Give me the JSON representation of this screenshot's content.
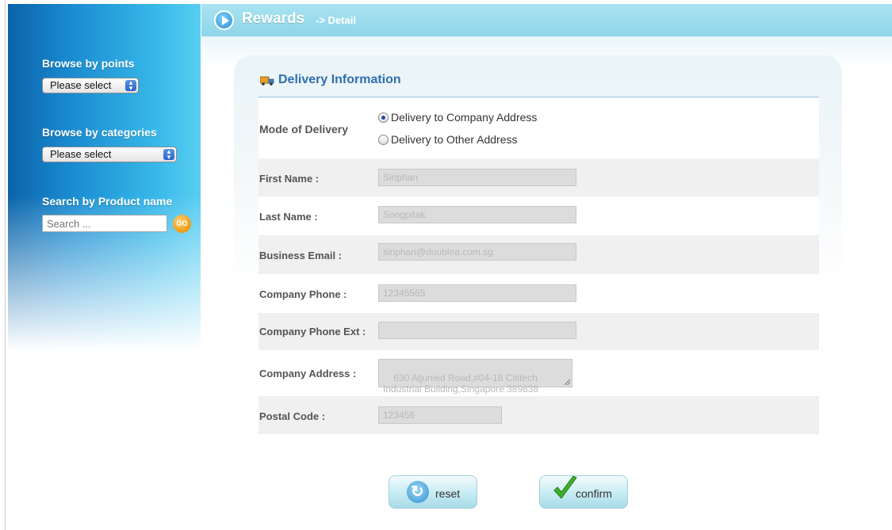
{
  "header": {
    "title": "Rewards",
    "subtitle": "-> Detail"
  },
  "sidebar": {
    "browse_points_heading": "Browse by points",
    "browse_points_select": "Please select",
    "browse_categories_heading": "Browse by categories",
    "browse_categories_select": "Please select",
    "search_heading": "Search by Product name",
    "search_placeholder": "Search ...",
    "go_label": "GO"
  },
  "panel": {
    "title": "Delivery Information",
    "mode_label": "Mode of Delivery",
    "delivery_options": [
      {
        "label": "Delivery to Company Address",
        "selected": true
      },
      {
        "label": "Delivery to Other Address",
        "selected": false
      }
    ],
    "fields": {
      "first_name": {
        "label": "First Name  :",
        "value": "Siriphan"
      },
      "last_name": {
        "label": "Last Name  :",
        "value": "Songpitak"
      },
      "business_email": {
        "label": "Business Email  :",
        "value": "siriphan@doublea.com.sg"
      },
      "company_phone": {
        "label": "Company Phone  :",
        "value": "12345565"
      },
      "company_phone_ext": {
        "label": "Company Phone Ext  :",
        "value": ""
      },
      "company_address": {
        "label": "Company Address  :",
        "value": "630 Aljunied Road,#04-18 Cititech Industrial Building,Singapore 389838"
      },
      "postal_code": {
        "label": "Postal Code  :",
        "value": "123456"
      }
    }
  },
  "buttons": {
    "reset": "reset",
    "confirm": "confirm"
  },
  "colors": {
    "accent": "#2f6fb0",
    "header": "#8ed6e9",
    "go": "#f2a21d"
  }
}
